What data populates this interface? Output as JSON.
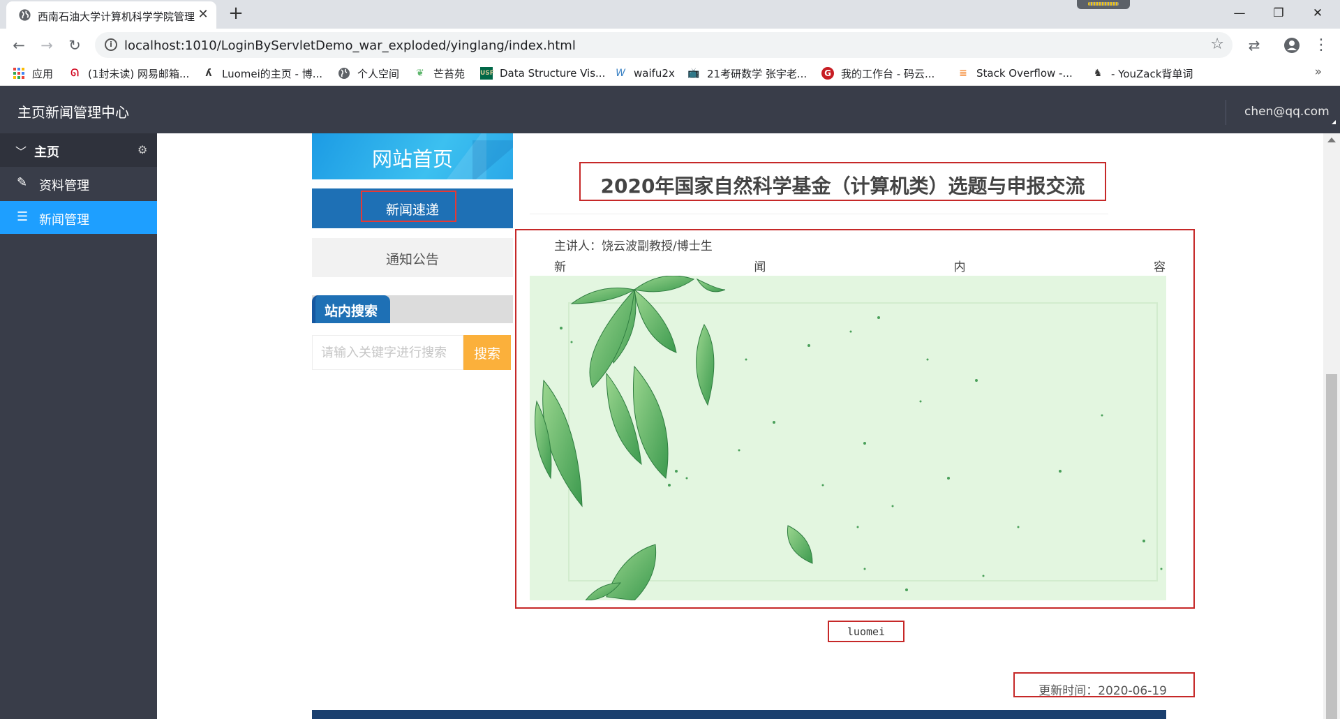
{
  "browser": {
    "tab_title": "西南石油大学计算机科学学院管理",
    "tab_close": "✕",
    "new_tab": "+",
    "url": "localhost:1010/LoginByServletDemo_war_exploded/yinglang/index.html",
    "bookmarks": [
      {
        "label": "应用",
        "icon": "apps-grid-icon"
      },
      {
        "label": "(1封未读) 网易邮箱...",
        "icon": "netease-mail-icon"
      },
      {
        "label": "Luomei的主页 - 博...",
        "icon": "blog-icon"
      },
      {
        "label": "个人空间",
        "icon": "globe-icon"
      },
      {
        "label": "芒苔苑",
        "icon": "leaf-icon"
      },
      {
        "label": "Data Structure Vis...",
        "icon": "usf-icon"
      },
      {
        "label": "waifu2x",
        "icon": "w-icon"
      },
      {
        "label": "21考研数学 张宇老...",
        "icon": "bilibili-icon"
      },
      {
        "label": "我的工作台 - 码云...",
        "icon": "gitee-icon"
      },
      {
        "label": "Stack Overflow -...",
        "icon": "stackoverflow-icon"
      },
      {
        "label": "- YouZack背单词",
        "icon": "youzack-icon"
      }
    ],
    "bookmarks_more": "»"
  },
  "app": {
    "title": "主页新闻管理中心",
    "user_email": "chen@qq.com"
  },
  "sidebar": {
    "section": "主页",
    "items": [
      {
        "label": "资料管理",
        "icon": "pencil-icon"
      },
      {
        "label": "新闻管理",
        "icon": "list-icon"
      }
    ]
  },
  "site_nav": {
    "home": "网站首页",
    "news": "新闻速递",
    "notice": "通知公告",
    "search_title": "站内搜索",
    "search_placeholder": "请输入关键字进行搜索",
    "search_button": "搜索"
  },
  "article": {
    "title": "2020年国家自然科学基金（计算机类）选题与申报交流",
    "speaker": "主讲人：饶云波副教授/博士生",
    "content_label": [
      "新",
      "闻",
      "内",
      "容"
    ],
    "author": "luomei",
    "updated": "更新时间：2020-06-19"
  },
  "colors": {
    "header_bg": "#393d49",
    "active_blue": "#1e9fff",
    "nav_blue": "#1e70b5",
    "search_orange": "#fbb03b",
    "highlight_red": "#c62828"
  }
}
